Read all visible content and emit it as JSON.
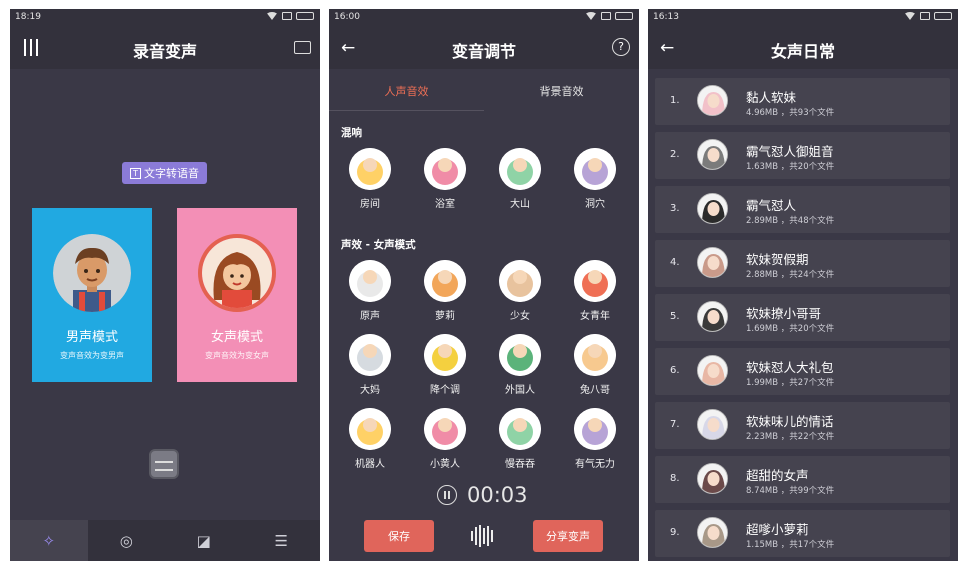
{
  "panel1": {
    "time": "18:19",
    "title": "录音变声",
    "tts_label": "文字转语音",
    "tts_icon_text": "T",
    "male": {
      "title": "男声模式",
      "subtitle": "变声音效为变男声"
    },
    "female": {
      "title": "女声模式",
      "subtitle": "变声音效为变女声"
    },
    "colors": {
      "male": "#21a9e1",
      "female": "#f38fb6",
      "accent": "#8b7bd8"
    },
    "tabs": [
      {
        "icon": "magic-wand-icon",
        "glyph": "✧"
      },
      {
        "icon": "voice-globe-icon",
        "glyph": "◎"
      },
      {
        "icon": "message-voice-icon",
        "glyph": "◪"
      },
      {
        "icon": "sliders-icon",
        "glyph": "☰"
      }
    ]
  },
  "panel2": {
    "time": "16:00",
    "title": "变音调节",
    "help_glyph": "?",
    "tabs": [
      "人声音效",
      "背景音效"
    ],
    "sections": {
      "reverb": "混响",
      "voice": "声效 - 女声模式"
    },
    "reverb_items": [
      {
        "label": "房间",
        "icon": "room-icon"
      },
      {
        "label": "浴室",
        "icon": "bathroom-icon"
      },
      {
        "label": "大山",
        "icon": "mountain-icon"
      },
      {
        "label": "洞穴",
        "icon": "cave-icon"
      }
    ],
    "voice_items": [
      {
        "label": "原声",
        "icon": "microphone-icon"
      },
      {
        "label": "萝莉",
        "icon": "loli-icon"
      },
      {
        "label": "少女",
        "icon": "girl-icon"
      },
      {
        "label": "女青年",
        "icon": "young-woman-icon"
      },
      {
        "label": "大妈",
        "icon": "auntie-icon"
      },
      {
        "label": "降个调",
        "icon": "lower-pitch-icon"
      },
      {
        "label": "外国人",
        "icon": "foreigner-icon"
      },
      {
        "label": "兔八哥",
        "icon": "bugs-bunny-icon"
      },
      {
        "label": "机器人",
        "icon": "robot-icon"
      },
      {
        "label": "小黄人",
        "icon": "minion-icon"
      },
      {
        "label": "慢吞吞",
        "icon": "turtle-icon"
      },
      {
        "label": "有气无力",
        "icon": "sleepy-icon"
      }
    ],
    "timer": "00:03",
    "save_label": "保存",
    "share_label": "分享变声",
    "colors": {
      "accent": "#e0655b"
    }
  },
  "panel3": {
    "time": "16:13",
    "title": "女声日常",
    "items": [
      {
        "num": "1.",
        "name": "黏人软妹",
        "meta": "4.96MB ，共93个文件"
      },
      {
        "num": "2.",
        "name": "霸气怼人御姐音",
        "meta": "1.63MB ，共20个文件"
      },
      {
        "num": "3.",
        "name": "霸气怼人",
        "meta": "2.89MB ，共48个文件"
      },
      {
        "num": "4.",
        "name": "软妹贺假期",
        "meta": "2.88MB ，共24个文件"
      },
      {
        "num": "5.",
        "name": "软妹撩小哥哥",
        "meta": "1.69MB ，共20个文件"
      },
      {
        "num": "6.",
        "name": "软妹怼人大礼包",
        "meta": "1.99MB ，共27个文件"
      },
      {
        "num": "7.",
        "name": "软妹味儿的情话",
        "meta": "2.23MB ，共22个文件"
      },
      {
        "num": "8.",
        "name": "超甜的女声",
        "meta": "8.74MB ，共99个文件"
      },
      {
        "num": "9.",
        "name": "超嗲小萝莉",
        "meta": "1.15MB ，共17个文件"
      }
    ]
  }
}
